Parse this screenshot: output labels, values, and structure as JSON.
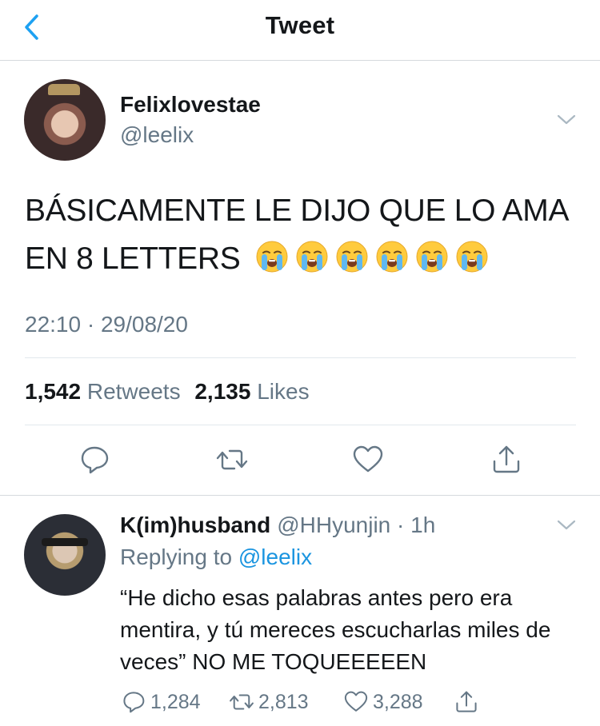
{
  "header": {
    "title": "Tweet",
    "back_icon": "chevron-left-icon",
    "accent": "#1da1f2"
  },
  "tweet": {
    "display_name": "Felixlovestae",
    "handle": "@leelix",
    "text": "BÁSICAMENTE LE DIJO QUE LO AMA EN 8 LETTERS",
    "emoji": [
      "😭",
      "😭",
      "😭",
      "😭",
      "😭",
      "😭"
    ],
    "timestamp": "22:10 · 29/08/20",
    "retweets": "1,542",
    "retweets_label": "Retweets",
    "likes": "2,135",
    "likes_label": "Likes",
    "actions": [
      "reply-icon",
      "retweet-icon",
      "like-icon",
      "share-icon"
    ]
  },
  "reply": {
    "display_name": "K(im)husband",
    "handle_time": "@HHyunjin · 1h",
    "replying_prefix": "Replying to",
    "replying_to": "@leelix",
    "text": "“He dicho esas palabras antes pero era mentira, y tú mereces escucharlas miles de veces” NO ME TOQUEEEEEN",
    "reply_count": "1,284",
    "retweet_count": "2,813",
    "like_count": "3,288"
  },
  "colors": {
    "secondary_text": "#657786",
    "link": "#1b95e0",
    "divider": "#e1e8ed"
  }
}
